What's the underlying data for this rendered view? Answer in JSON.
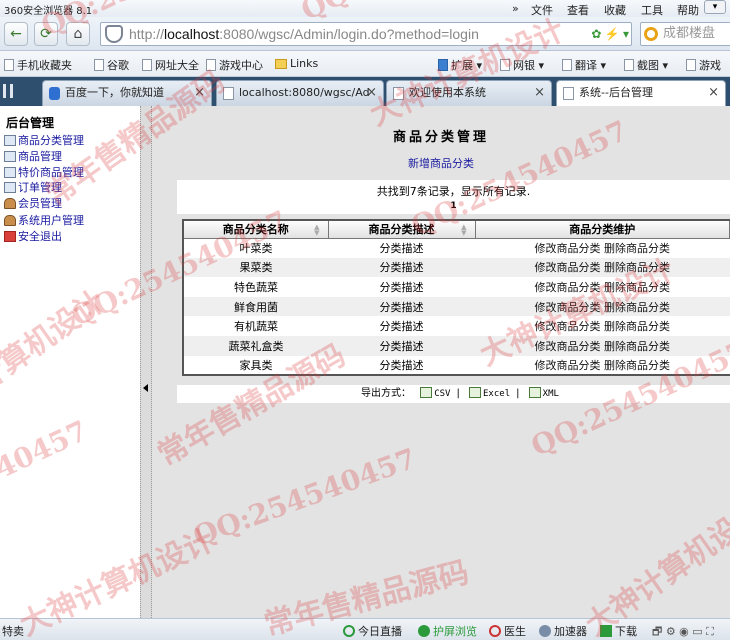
{
  "browser": {
    "title": "360安全浏览器 8.1",
    "menu": [
      "»",
      "文件",
      "查看",
      "收藏",
      "工具",
      "帮助"
    ],
    "url_host": "localhost",
    "url_rest": ":8080/wgsc/Admin/login.do?method=login",
    "search_placeholder": "成都楼盘"
  },
  "bookmarks": [
    "手机收藏夹",
    "谷歌",
    "网址大全",
    "游戏中心",
    "Links",
    "扩展",
    "网银",
    "翻译",
    "截图",
    "游戏"
  ],
  "tabs": [
    {
      "label": "百度一下，你就知道",
      "active": false
    },
    {
      "label": "localhost:8080/wgsc/Ad",
      "active": false
    },
    {
      "label": "欢迎使用本系统",
      "active": false
    },
    {
      "label": "系统--后台管理",
      "active": true
    }
  ],
  "sidebar": {
    "title": "后台管理",
    "items": [
      {
        "label": "商品分类管理"
      },
      {
        "label": "商品管理"
      },
      {
        "label": "特价商品管理"
      },
      {
        "label": "订单管理"
      },
      {
        "label": "会员管理"
      },
      {
        "label": "系统用户管理"
      },
      {
        "label": "安全退出"
      }
    ]
  },
  "main": {
    "heading": "商品分类管理",
    "add_link": "新增商品分类",
    "summary": "共找到7条记录，显示所有记录.",
    "page": "1",
    "columns": [
      "商品分类名称",
      "商品分类描述",
      "商品分类维护"
    ],
    "rows": [
      {
        "name": "叶菜类",
        "desc": "分类描述",
        "edit": "修改商品分类",
        "del": "删除商品分类"
      },
      {
        "name": "果菜类",
        "desc": "分类描述",
        "edit": "修改商品分类",
        "del": "删除商品分类"
      },
      {
        "name": "特色蔬菜",
        "desc": "分类描述",
        "edit": "修改商品分类",
        "del": "删除商品分类"
      },
      {
        "name": "鲜食用菌",
        "desc": "分类描述",
        "edit": "修改商品分类",
        "del": "删除商品分类"
      },
      {
        "name": "有机蔬菜",
        "desc": "分类描述",
        "edit": "修改商品分类",
        "del": "删除商品分类"
      },
      {
        "name": "蔬菜礼盒类",
        "desc": "分类描述",
        "edit": "修改商品分类",
        "del": "删除商品分类"
      },
      {
        "name": "家具类",
        "desc": "分类描述",
        "edit": "修改商品分类",
        "del": "删除商品分类"
      }
    ],
    "export_label": "导出方式：",
    "export_formats": [
      "CSV",
      "Excel",
      "XML"
    ]
  },
  "statusbar": [
    "特卖",
    "今日直播",
    "护屏浏览",
    "医生",
    "加速器",
    "下载"
  ],
  "watermarks": [
    "QQ:254540457",
    "大神计算机设计",
    "常年售精品源码"
  ]
}
